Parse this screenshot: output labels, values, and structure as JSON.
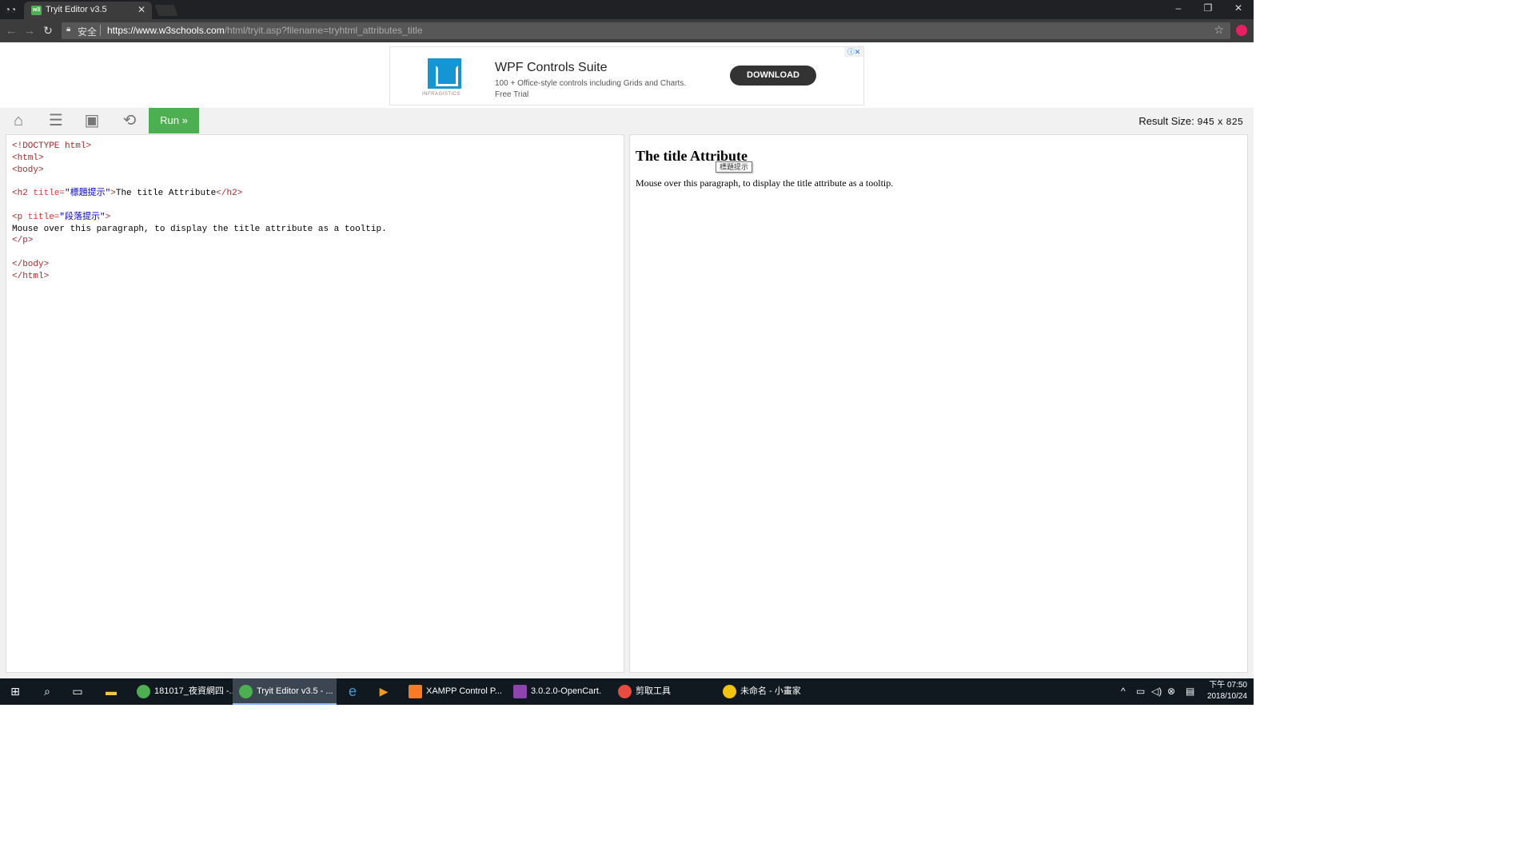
{
  "browser": {
    "tab_title": "Tryit Editor v3.5",
    "tab_close": "✕",
    "secure_label": "安全",
    "url_host": "https://www.w3schools.com",
    "url_path": "/html/tryit.asp?filename=tryhtml_attributes_title",
    "minimize": "–",
    "maximize": "❐",
    "close": "✕"
  },
  "ad": {
    "brand": "INFRAGISTICS",
    "title": "WPF Controls Suite",
    "text": "100 + Office-style controls including Grids and Charts. Free Trial",
    "button": "DOWNLOAD",
    "close": "ⓘ✕"
  },
  "toolbar": {
    "run_label": "Run »",
    "result_size_label": "Result Size:",
    "result_width": "945",
    "result_x": "x",
    "result_height": "825"
  },
  "code": {
    "line1": "<!DOCTYPE html>",
    "line2": "<html>",
    "line3": "<body>",
    "h2_open": "<h2",
    "h2_attr": " title=",
    "h2_val": "\"標題提示\"",
    "h2_close_bracket": ">",
    "h2_text": "The title Attribute",
    "h2_end": "</h2>",
    "p_open": "<p",
    "p_attr": " title=",
    "p_val": "\"段落提示\"",
    "p_close_bracket": ">",
    "p_text": "Mouse over this paragraph, to display the title attribute as a tooltip.",
    "p_end": "</p>",
    "body_end": "</body>",
    "html_end": "</html>"
  },
  "result": {
    "heading": "The title Attribute",
    "paragraph": "Mouse over this paragraph, to display the title attribute as a tooltip.",
    "tooltip": "標題提示"
  },
  "taskbar": {
    "apps": [
      {
        "label": "181017_夜資網四 -..."
      },
      {
        "label": "Tryit Editor v3.5 - ..."
      },
      {
        "label": "XAMPP Control P..."
      },
      {
        "label": "3.0.2.0-OpenCart."
      },
      {
        "label": "剪取工具"
      },
      {
        "label": "未命名 - 小畫家"
      }
    ],
    "time": "下午 07:50",
    "date": "2018/10/24"
  }
}
